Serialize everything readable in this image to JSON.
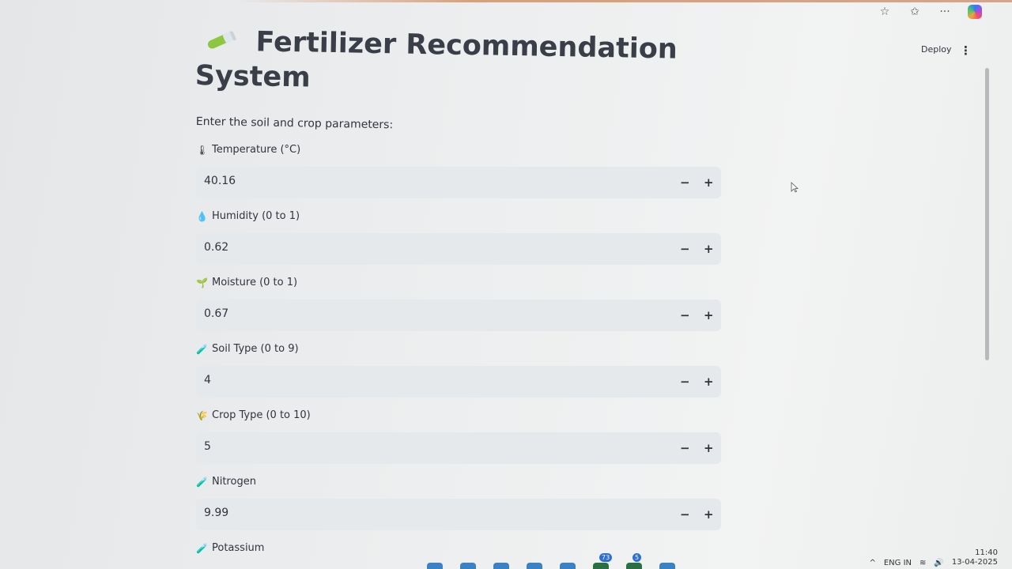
{
  "browser": {
    "actions": [
      {
        "name": "favorites-star-icon",
        "glyph": "☆"
      },
      {
        "name": "collections-icon",
        "glyph": "✩"
      },
      {
        "name": "more-icon",
        "glyph": "···"
      }
    ]
  },
  "app": {
    "title": "Fertilizer Recommendation System",
    "subtitle": "Enter the soil and crop parameters:",
    "deploy_label": "Deploy",
    "menu_icon": "⋮"
  },
  "fields": [
    {
      "icon": "🌡",
      "icon_name": "thermometer-icon",
      "label": "Temperature (°C)",
      "value": "40.16"
    },
    {
      "icon": "💧",
      "icon_name": "droplet-icon",
      "label": "Humidity (0 to 1)",
      "value": "0.62"
    },
    {
      "icon": "🌱",
      "icon_name": "seedling-icon",
      "label": "Moisture (0 to 1)",
      "value": "0.67"
    },
    {
      "icon": "🧪",
      "icon_name": "soil-icon",
      "label": "Soil Type (0 to 9)",
      "value": "4"
    },
    {
      "icon": "🌾",
      "icon_name": "crop-icon",
      "label": "Crop Type (0 to 10)",
      "value": "5"
    },
    {
      "icon": "🧪",
      "icon_name": "test-tube-icon",
      "label": "Nitrogen",
      "value": "9.99"
    },
    {
      "icon": "🧪",
      "icon_name": "test-tube-icon",
      "label": "Potassium",
      "value": ""
    }
  ],
  "stepper": {
    "minus": "−",
    "plus": "+"
  },
  "taskbar": {
    "lang": "ENG",
    "lang_sub": "IN",
    "time": "11:40",
    "date": "13-04-2025",
    "badge_a": "73",
    "badge_b": "5"
  },
  "colors": {
    "accent": "#d9a07a",
    "input_bg": "#e6e9eb",
    "text": "#31333f"
  }
}
